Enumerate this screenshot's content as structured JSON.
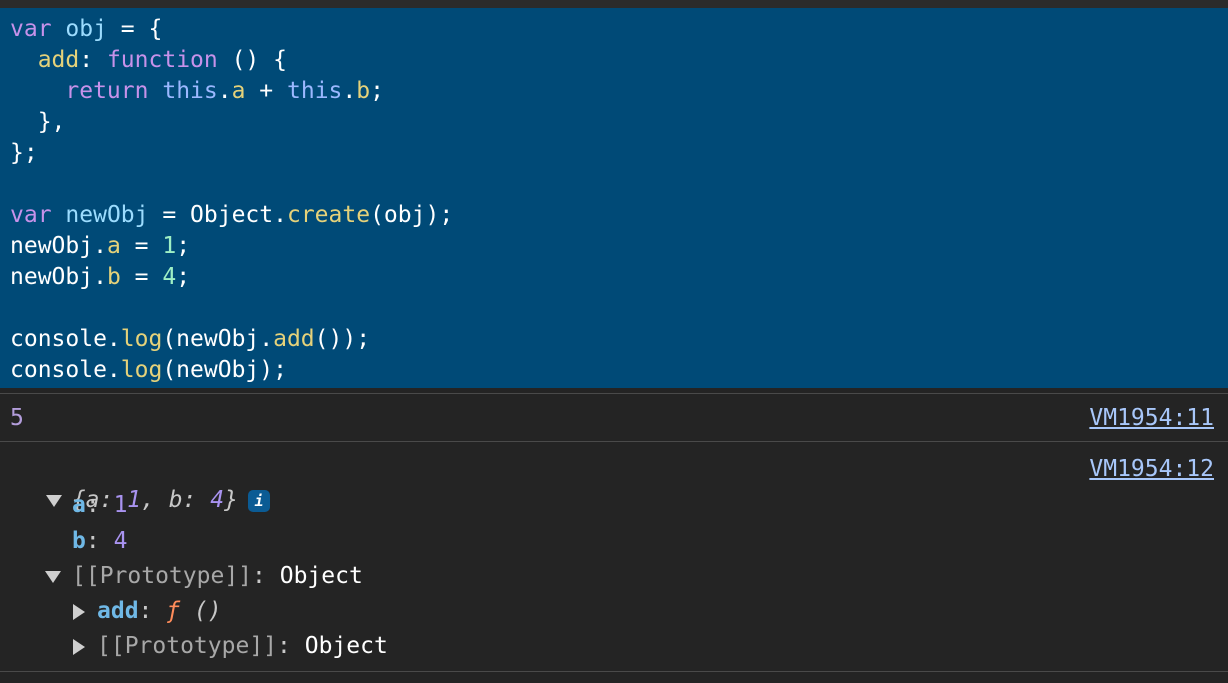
{
  "code": {
    "l1_kw": "var",
    "l1_name": "obj",
    "l1_rest": " = {",
    "l2_key": "add",
    "l2_colon": ": ",
    "l2_kw": "function",
    "l2_rest": " () {",
    "l3_kw": "return",
    "l3_this1": "this",
    "l3_dot1": ".",
    "l3_prop1": "a",
    "l3_plus": " + ",
    "l3_this2": "this",
    "l3_dot2": ".",
    "l3_prop2": "b",
    "l3_semi": ";",
    "l4": "},",
    "l5": "};",
    "l7_kw": "var",
    "l7_name": "newObj",
    "l7_mid": " = Object.",
    "l7_fn": "create",
    "l7_rest": "(obj);",
    "l8_obj": "newObj.",
    "l8_prop": "a",
    "l8_eq": " = ",
    "l8_num": "1",
    "l8_semi": ";",
    "l9_obj": "newObj.",
    "l9_prop": "b",
    "l9_eq": " = ",
    "l9_num": "4",
    "l9_semi": ";",
    "l11_obj": "console.",
    "l11_fn": "log",
    "l11_mid": "(newObj.",
    "l11_fn2": "add",
    "l11_rest": "());",
    "l12_obj": "console.",
    "l12_fn": "log",
    "l12_rest": "(newObj);"
  },
  "output": {
    "result_value": "5",
    "result_source": "VM1954:11",
    "object_source": "VM1954:12",
    "summary_open": "{",
    "summary_a_key": "a",
    "summary_sep1": ": ",
    "summary_a_val": "1",
    "summary_comma": ", ",
    "summary_b_key": "b",
    "summary_sep2": ": ",
    "summary_b_val": "4",
    "summary_close": "}",
    "info_badge": "i",
    "prop_a_key": "a",
    "prop_a_colon": ": ",
    "prop_a_val": "1",
    "prop_b_key": "b",
    "prop_b_colon": ": ",
    "prop_b_val": "4",
    "proto_label": "[[Prototype]]",
    "proto_colon": ": ",
    "proto_value": "Object",
    "add_key": "add",
    "add_colon": ": ",
    "add_f": "ƒ",
    "add_sig": " ()",
    "proto2_label": "[[Prototype]]",
    "proto2_colon": ": ",
    "proto2_value": "Object"
  }
}
